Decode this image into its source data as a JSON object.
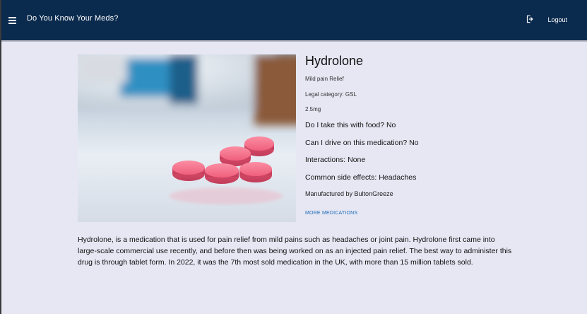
{
  "header": {
    "title": "Do You Know Your Meds?",
    "logout_label": "Logout",
    "background": "#0b2b4e"
  },
  "medication": {
    "name": "Hydrolone",
    "purpose": "Mild pain Relief",
    "legal_category": "Legal category: GSL",
    "dose": "2.5mg",
    "with_food": "Do I take this with food? No",
    "drive": "Can I drive on this medication? No",
    "interactions": "Interactions: None",
    "side_effects": "Common side effects: Headaches",
    "manufacturer_prefix": "Manufactured by ",
    "manufacturer": "BultonGreeze",
    "more_link": "MORE MEDICATIONS",
    "description": "Hydrolone, is a medication that is used for pain relief from mild pains such as headaches or joint pain. Hydrolone first came into large-scale commercial use recently, and before then was being worked on as an injected pain relief. The best way to administer this drug is through tablet form. In 2022, it was the 7th most sold medication in the UK, with more than 15 million tablets sold."
  },
  "icons": {
    "menu": "hamburger-menu-icon",
    "logout": "logout-icon"
  },
  "colors": {
    "page_bg": "#e6e7f3",
    "link": "#1e6bb8",
    "pill": "#f06a86"
  }
}
